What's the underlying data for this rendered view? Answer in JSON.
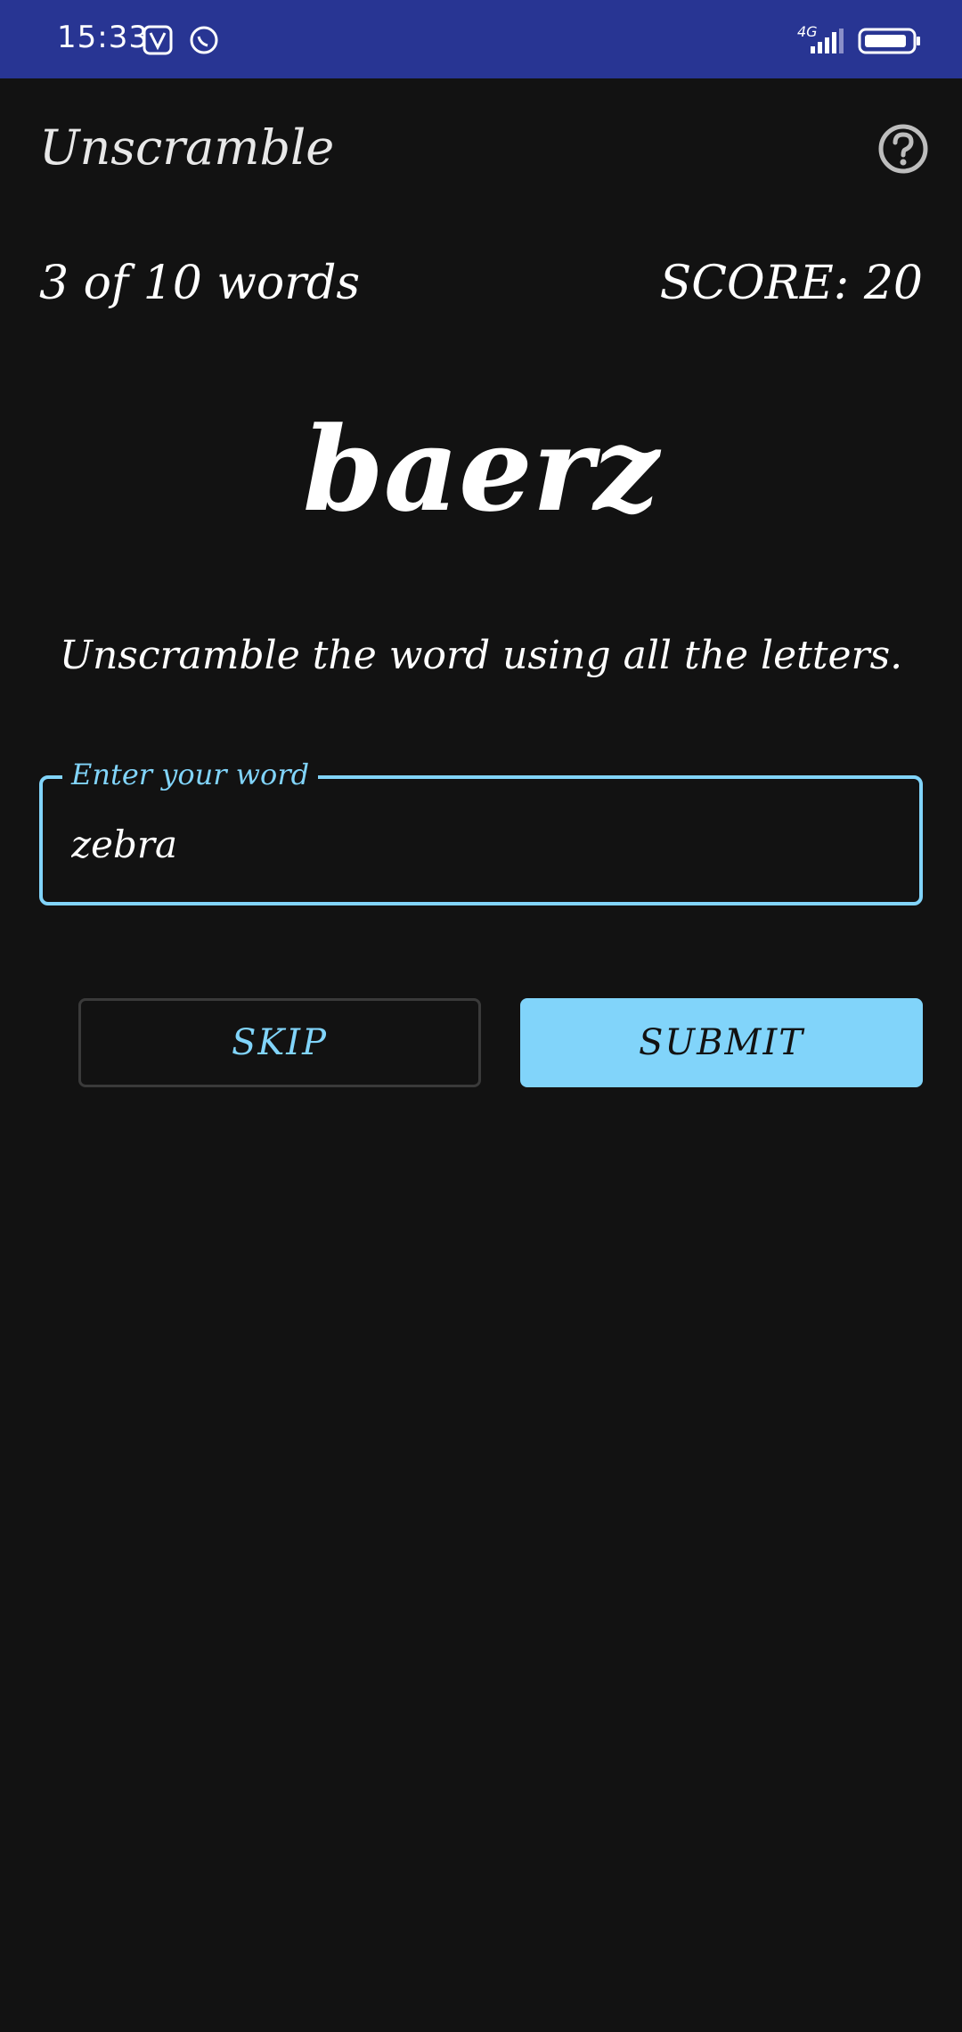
{
  "status_bar": {
    "time": "15:33",
    "network": "4G",
    "background_color": "#283593",
    "icons": [
      "music-app-icon",
      "whatsapp-icon",
      "signal-icon",
      "battery-icon"
    ]
  },
  "app_bar": {
    "title": "Unscramble",
    "help_icon": "help-circle-icon"
  },
  "game": {
    "progress": "3 of 10 words",
    "score": "SCORE: 20",
    "scrambled_word": "baerz",
    "instructions": "Unscramble the word using all the letters."
  },
  "input": {
    "label": "Enter your word",
    "value": "zebra"
  },
  "buttons": {
    "skip_label": "SKIP",
    "submit_label": "SUBMIT"
  },
  "colors": {
    "accent": "#81d4fa",
    "background": "#121212"
  }
}
